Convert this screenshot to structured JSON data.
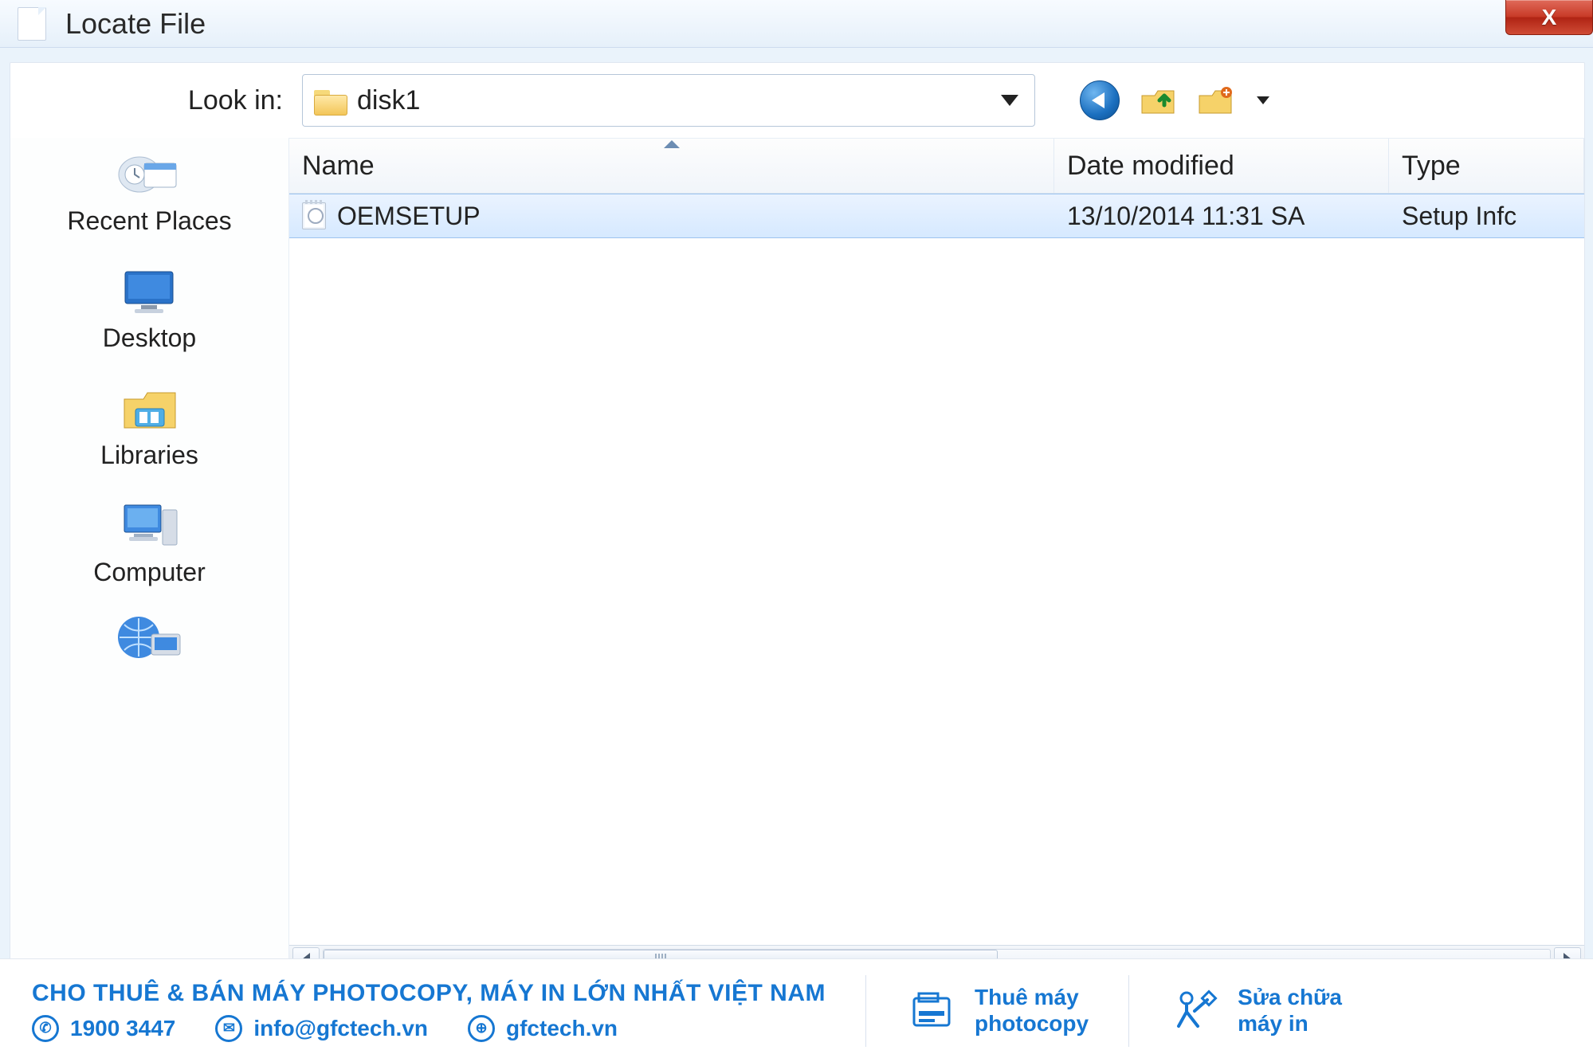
{
  "window": {
    "title": "Locate File",
    "close_glyph": "X"
  },
  "lookin": {
    "label": "Look in:",
    "folder": "disk1"
  },
  "toolbar": {
    "back": "Back",
    "up": "Up one level",
    "new_folder": "Create new folder",
    "views": "Views"
  },
  "sidebar": {
    "places": [
      {
        "label": "Recent Places"
      },
      {
        "label": "Desktop"
      },
      {
        "label": "Libraries"
      },
      {
        "label": "Computer"
      }
    ]
  },
  "columns": {
    "name": "Name",
    "date": "Date modified",
    "type": "Type"
  },
  "files": [
    {
      "name": "OEMSETUP",
      "date": "13/10/2014 11:31 SA",
      "type": "Setup Infc",
      "selected": true
    }
  ],
  "banner": {
    "headline": "CHO THUÊ & BÁN MÁY PHOTOCOPY, MÁY IN LỚN NHẤT VIỆT NAM",
    "phone": "1900 3447",
    "email": "info@gfctech.vn",
    "web": "gfctech.vn",
    "service1_line1": "Thuê máy",
    "service1_line2": "photocopy",
    "service2_line1": "Sửa chữa",
    "service2_line2": "máy in"
  }
}
